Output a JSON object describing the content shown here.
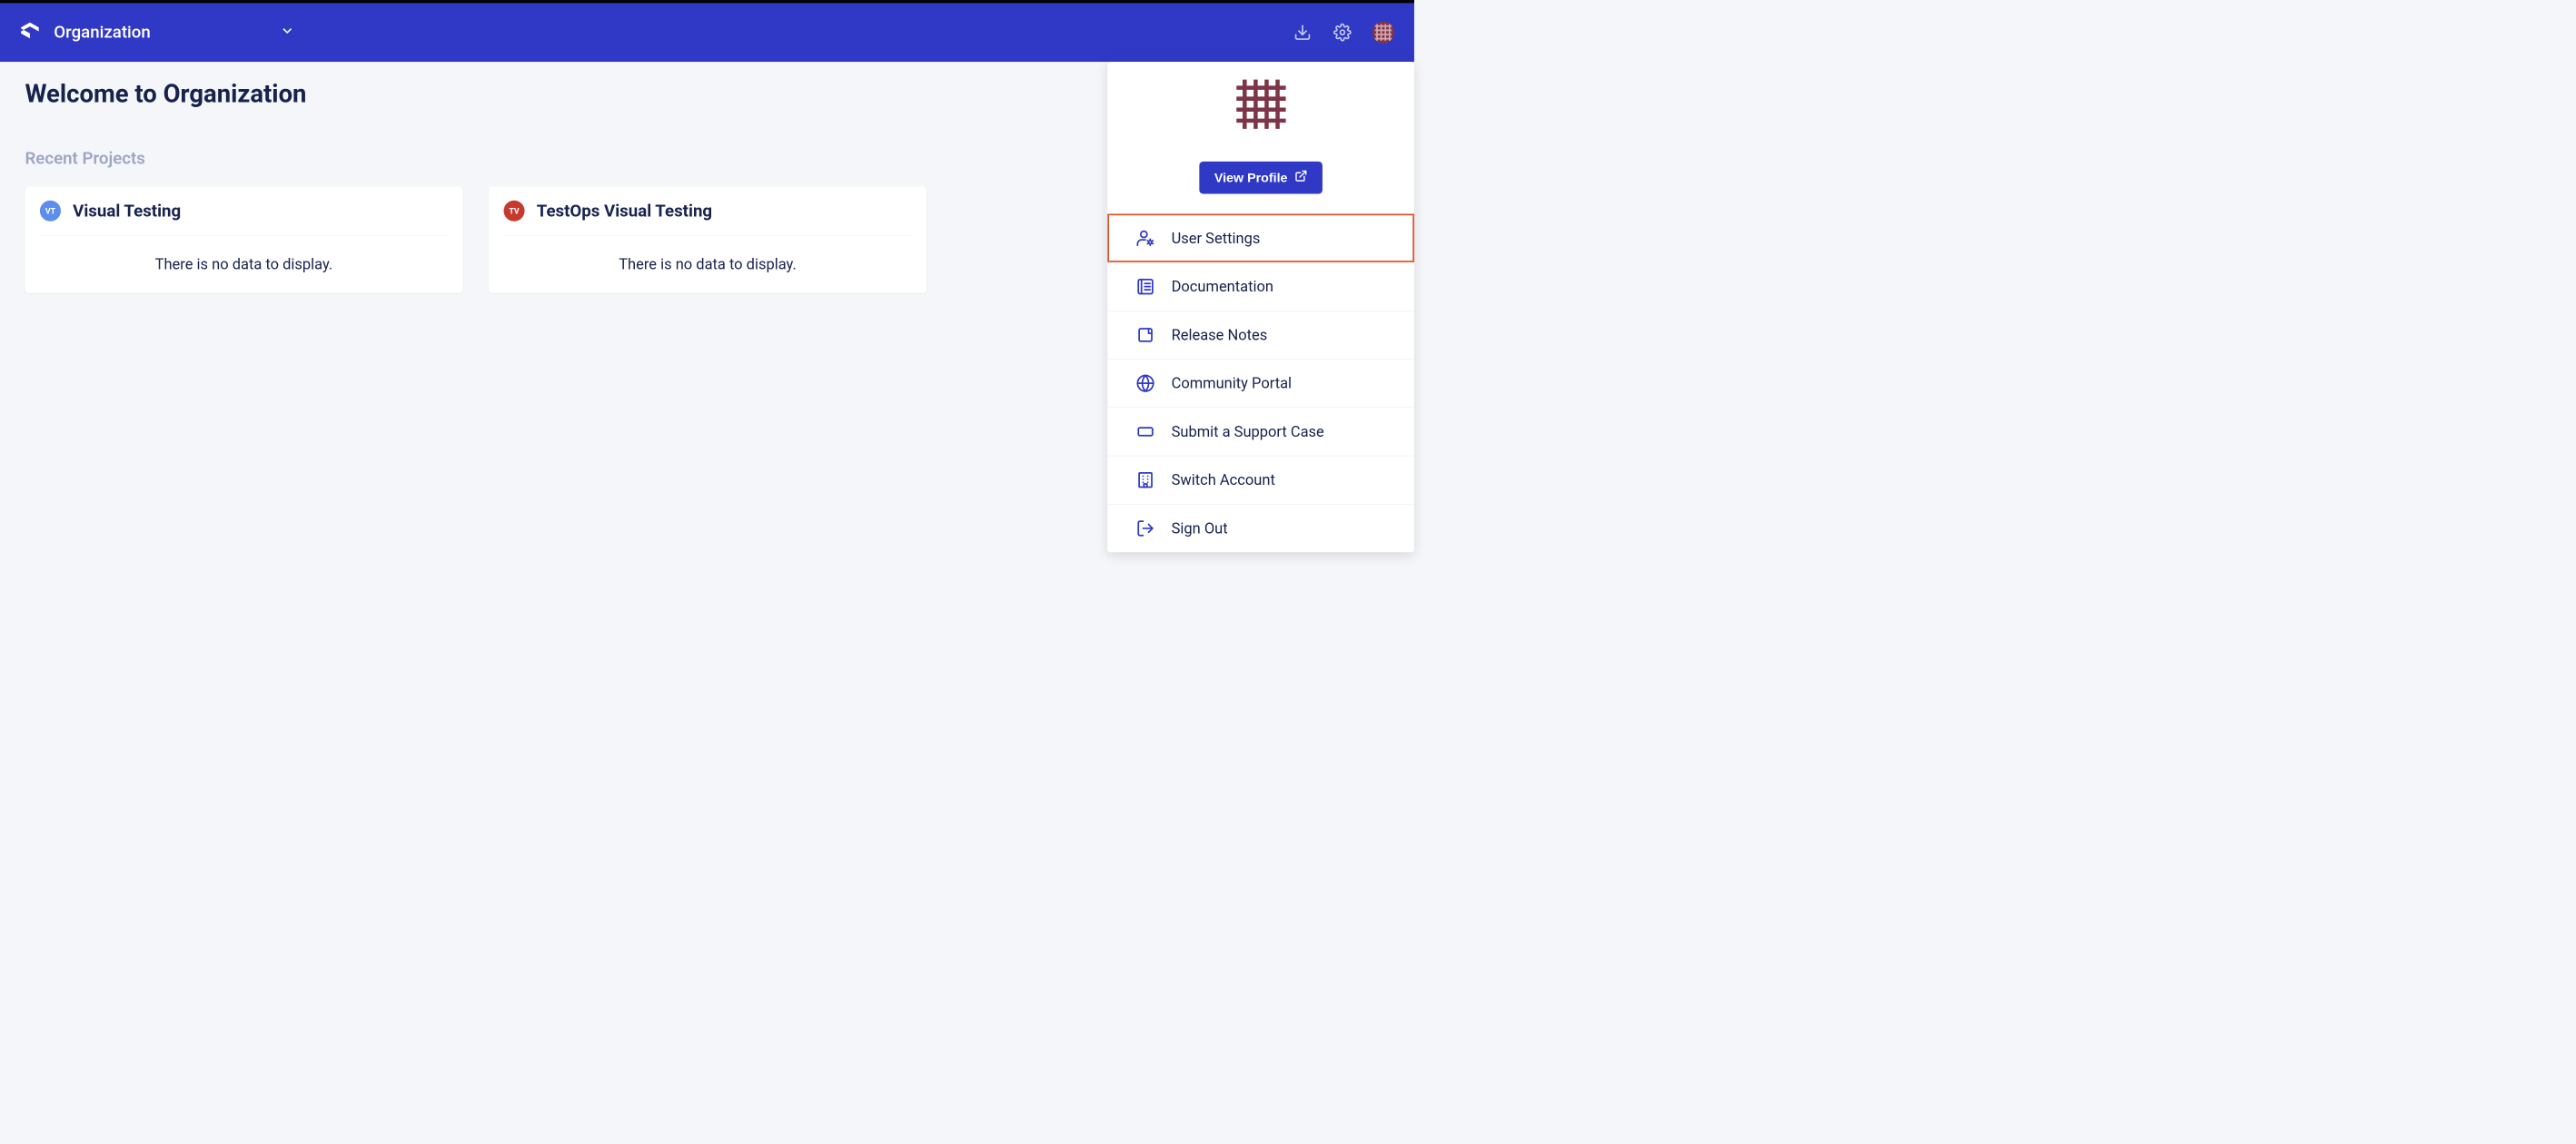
{
  "header": {
    "org_label": "Organization"
  },
  "page": {
    "title": "Welcome to Organization",
    "recent_projects_label": "Recent Projects"
  },
  "projects": [
    {
      "badge_text": "VT",
      "badge_color": "blue",
      "name": "Visual Testing",
      "empty_message": "There is no data to display."
    },
    {
      "badge_text": "TV",
      "badge_color": "red",
      "name": "TestOps Visual Testing",
      "empty_message": "There is no data to display."
    }
  ],
  "user_menu": {
    "view_profile_label": "View Profile",
    "items": [
      {
        "icon": "user-settings-icon",
        "label": "User Settings",
        "highlighted": true
      },
      {
        "icon": "documentation-icon",
        "label": "Documentation",
        "highlighted": false
      },
      {
        "icon": "release-notes-icon",
        "label": "Release Notes",
        "highlighted": false
      },
      {
        "icon": "community-portal-icon",
        "label": "Community Portal",
        "highlighted": false
      },
      {
        "icon": "support-ticket-icon",
        "label": "Submit a Support Case",
        "highlighted": false
      },
      {
        "icon": "switch-account-icon",
        "label": "Switch Account",
        "highlighted": false
      },
      {
        "icon": "sign-out-icon",
        "label": "Sign Out",
        "highlighted": false
      }
    ]
  },
  "colors": {
    "brand_primary": "#2f39c5",
    "avatar": "#7d3548",
    "highlight": "#e24a1c"
  }
}
